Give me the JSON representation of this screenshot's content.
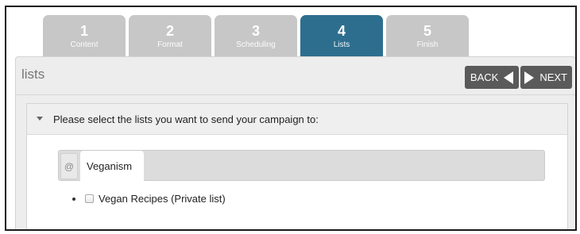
{
  "wizard": {
    "steps": [
      {
        "number": "1",
        "label": "Content"
      },
      {
        "number": "2",
        "label": "Format"
      },
      {
        "number": "3",
        "label": "Scheduling"
      },
      {
        "number": "4",
        "label": "Lists"
      },
      {
        "number": "5",
        "label": "Finish"
      }
    ],
    "active_step": "4"
  },
  "panel": {
    "title": "lists",
    "back_label": "BACK",
    "next_label": "NEXT"
  },
  "section": {
    "header": "Please select the lists you want to send your campaign to:",
    "at_tab_label": "@",
    "category_tab_label": "Veganism",
    "lists": [
      {
        "name": "Vegan Recipes (Private list)",
        "checked": false
      }
    ]
  },
  "colors": {
    "active_step": "#2d6e8e",
    "inactive_step": "#c7c7c7",
    "nav_button": "#5a5a5a"
  }
}
